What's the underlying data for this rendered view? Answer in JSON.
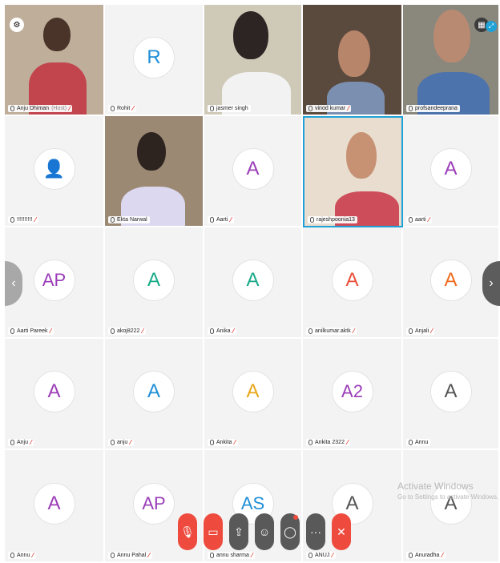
{
  "colors": {
    "active_border": "#1fa2d8",
    "muted": "#e03c2f",
    "end_red": "#ee4b3e"
  },
  "tiles": [
    {
      "name": "Anju Dhiman",
      "host": "(Host)",
      "kind": "video",
      "muted": true
    },
    {
      "name": "Rohit",
      "initials": "R",
      "color": "#1f8ed6",
      "kind": "avatar",
      "muted": true
    },
    {
      "name": "jasmer singh",
      "kind": "video",
      "muted": false
    },
    {
      "name": "vinod kumar",
      "kind": "video",
      "muted": true
    },
    {
      "name": "profsandeeprana",
      "kind": "video",
      "muted": false
    },
    {
      "name": "!!!!!!!!!!",
      "initials": "",
      "color": "#999999",
      "kind": "avatar",
      "muted": true
    },
    {
      "name": "Ekta Narwal",
      "kind": "video",
      "muted": false
    },
    {
      "name": "Aarti",
      "initials": "A",
      "color": "#9b3db8",
      "kind": "avatar",
      "muted": true
    },
    {
      "name": "rajeshpoonia13",
      "kind": "video",
      "muted": false,
      "active": true
    },
    {
      "name": "aarti",
      "initials": "A",
      "color": "#9b3db8",
      "kind": "avatar",
      "muted": true
    },
    {
      "name": "Aarti Pareek",
      "initials": "AP",
      "color": "#9b3db8",
      "kind": "avatar",
      "muted": true
    },
    {
      "name": "akoj8222",
      "initials": "A",
      "color": "#1aaa88",
      "kind": "avatar",
      "muted": true
    },
    {
      "name": "Anika",
      "initials": "A",
      "color": "#1aaa88",
      "kind": "avatar",
      "muted": true
    },
    {
      "name": "anilkumar.aktk",
      "initials": "A",
      "color": "#e8503a",
      "kind": "avatar",
      "muted": true
    },
    {
      "name": "Anjali",
      "initials": "A",
      "color": "#ef6c1c",
      "kind": "avatar",
      "muted": true
    },
    {
      "name": "Anju",
      "initials": "A",
      "color": "#9b3db8",
      "kind": "avatar",
      "muted": true
    },
    {
      "name": "anju",
      "initials": "A",
      "color": "#1f8ed6",
      "kind": "avatar",
      "muted": true
    },
    {
      "name": "Ankita",
      "initials": "A",
      "color": "#e8a81c",
      "kind": "avatar",
      "muted": true
    },
    {
      "name": "Ankita 2322",
      "initials": "A2",
      "color": "#9b3db8",
      "kind": "avatar",
      "muted": true
    },
    {
      "name": "Annu",
      "initials": "A",
      "color": "#555555",
      "kind": "avatar",
      "muted": false
    },
    {
      "name": "Annu",
      "initials": "A",
      "color": "#9b3db8",
      "kind": "avatar",
      "muted": true
    },
    {
      "name": "Annu Pahal",
      "initials": "AP",
      "color": "#9b3db8",
      "kind": "avatar",
      "muted": true
    },
    {
      "name": "annu sharma",
      "initials": "AS",
      "color": "#1f8ed6",
      "kind": "avatar",
      "muted": true
    },
    {
      "name": "ANUJ",
      "initials": "A",
      "color": "#555555",
      "kind": "avatar",
      "muted": true
    },
    {
      "name": "Anuradha",
      "initials": "A",
      "color": "#555555",
      "kind": "avatar",
      "muted": true
    }
  ],
  "navigation": {
    "prev_icon": "‹",
    "next_icon": "›"
  },
  "toolbar": [
    {
      "id": "mute",
      "icon": "mic-off-icon",
      "glyph": "🎙",
      "style": "red"
    },
    {
      "id": "video",
      "icon": "video-off-icon",
      "glyph": "▭",
      "style": "red"
    },
    {
      "id": "share",
      "icon": "share-icon",
      "glyph": "⇪",
      "style": "dark"
    },
    {
      "id": "participants",
      "icon": "participants-icon",
      "glyph": "☺",
      "style": "dark"
    },
    {
      "id": "chat",
      "icon": "chat-icon",
      "glyph": "◯",
      "style": "dark",
      "badge": true
    },
    {
      "id": "more",
      "icon": "more-icon",
      "glyph": "···",
      "style": "dark"
    },
    {
      "id": "end",
      "icon": "end-call-icon",
      "glyph": "✕",
      "style": "red"
    }
  ],
  "watermark": {
    "line1": "Activate Windows",
    "line2": "Go to Settings to activate Windows."
  }
}
